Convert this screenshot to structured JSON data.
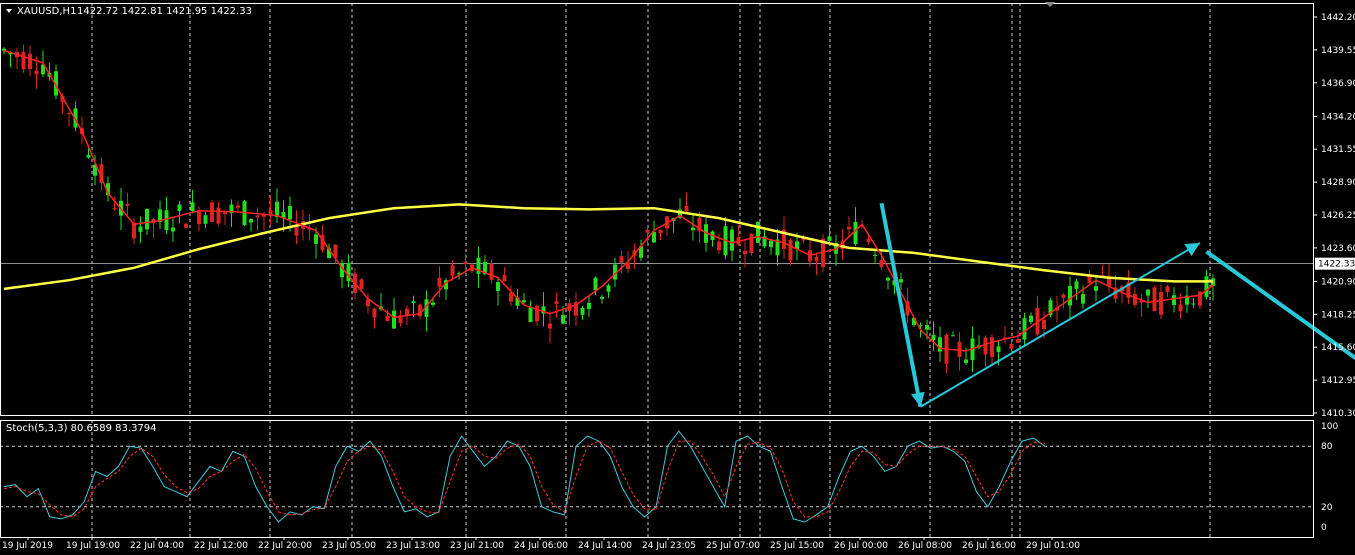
{
  "colors": {
    "background": "#000000",
    "bull": "#22dd22",
    "bear": "#dd2222",
    "ma_fast": "#ff2222",
    "ma_slow": "#ffff44",
    "arrow": "#28c8d8",
    "stoch_main": "#40c8d8",
    "stoch_signal": "#ff3333",
    "grid": "#ffffff",
    "price_tag_bg": "#ffffff",
    "price_tag_text": "#000000"
  },
  "header": {
    "symbol": "XAUUSD,H1",
    "values": "1422.72 1422.81 1421.95 1422.33"
  },
  "stoch_header": {
    "label": "Stoch(5,3,3) 80.6589 83.3794"
  },
  "chart_data": [
    {
      "type": "candlestick",
      "title": "XAUUSD,H1",
      "ylim": [
        1410.3,
        1443.0
      ],
      "y_ticks": [
        "1442.20",
        "1439.55",
        "1436.90",
        "1434.20",
        "1431.55",
        "1428.90",
        "1426.25",
        "1423.60",
        "1420.90",
        "1418.25",
        "1415.60",
        "1412.95",
        "1410.30"
      ],
      "current_price": "1422.33",
      "x_ticks": [
        "19 Jul 2019",
        "19 Jul 19:00",
        "22 Jul 04:00",
        "22 Jul 12:00",
        "22 Jul 20:00",
        "23 Jul 05:00",
        "23 Jul 13:00",
        "23 Jul 21:00",
        "24 Jul 06:00",
        "24 Jul 14:00",
        "24 Jul 23:05",
        "25 Jul 07:00",
        "25 Jul 15:00",
        "26 Jul 00:00",
        "26 Jul 08:00",
        "26 Jul 16:00",
        "29 Jul 01:00"
      ],
      "ma_fast_points": [
        [
          0,
          1439.5
        ],
        [
          6,
          1438.5
        ],
        [
          12,
          1433.0
        ],
        [
          16,
          1428.0
        ],
        [
          20,
          1425.5
        ],
        [
          24,
          1425.8
        ],
        [
          30,
          1426.6
        ],
        [
          36,
          1426.5
        ],
        [
          42,
          1426.2
        ],
        [
          48,
          1425.0
        ],
        [
          52,
          1422.0
        ],
        [
          56,
          1419.5
        ],
        [
          60,
          1418.0
        ],
        [
          64,
          1418.3
        ],
        [
          68,
          1420.8
        ],
        [
          72,
          1422.0
        ],
        [
          76,
          1421.2
        ],
        [
          80,
          1419.0
        ],
        [
          84,
          1418.3
        ],
        [
          88,
          1419.0
        ],
        [
          92,
          1420.5
        ],
        [
          96,
          1422.5
        ],
        [
          100,
          1425.0
        ],
        [
          104,
          1426.2
        ],
        [
          108,
          1424.8
        ],
        [
          112,
          1424.0
        ],
        [
          116,
          1424.5
        ],
        [
          120,
          1424.0
        ],
        [
          124,
          1423.0
        ],
        [
          128,
          1423.5
        ],
        [
          132,
          1425.5
        ],
        [
          135,
          1423.0
        ],
        [
          138,
          1420.0
        ],
        [
          141,
          1417.0
        ],
        [
          144,
          1415.5
        ],
        [
          148,
          1415.3
        ],
        [
          152,
          1416.0
        ],
        [
          156,
          1416.5
        ],
        [
          160,
          1418.0
        ],
        [
          164,
          1419.5
        ],
        [
          168,
          1421.0
        ],
        [
          172,
          1420.0
        ],
        [
          176,
          1419.2
        ],
        [
          180,
          1419.5
        ],
        [
          184,
          1419.8
        ],
        [
          186,
          1420.6
        ]
      ],
      "ma_slow_points": [
        [
          0,
          1420.3
        ],
        [
          10,
          1421.0
        ],
        [
          20,
          1422.0
        ],
        [
          30,
          1423.5
        ],
        [
          40,
          1424.8
        ],
        [
          50,
          1426.0
        ],
        [
          60,
          1426.8
        ],
        [
          70,
          1427.1
        ],
        [
          80,
          1426.8
        ],
        [
          90,
          1426.7
        ],
        [
          100,
          1426.8
        ],
        [
          110,
          1426.0
        ],
        [
          120,
          1424.8
        ],
        [
          130,
          1423.6
        ],
        [
          140,
          1423.2
        ],
        [
          150,
          1422.5
        ],
        [
          160,
          1421.8
        ],
        [
          170,
          1421.2
        ],
        [
          180,
          1420.9
        ],
        [
          186,
          1420.9
        ]
      ],
      "arrows": [
        {
          "from": [
            135,
            1427.2
          ],
          "to": [
            141,
            1410.8
          ]
        },
        {
          "from": [
            141,
            1410.8
          ],
          "to": [
            184,
            1424.0
          ]
        },
        {
          "from": [
            185,
            1423.3
          ],
          "to": [
            212,
            1413.2
          ]
        }
      ]
    },
    {
      "type": "line",
      "title": "Stoch(5,3,3) 80.6589 83.3794",
      "ylim": [
        0,
        100
      ],
      "y_ticks": [
        "100",
        "80",
        "20",
        "0"
      ],
      "levels": [
        80,
        20
      ],
      "series": [
        {
          "name": "main",
          "values": [
            40,
            42,
            30,
            38,
            10,
            8,
            12,
            25,
            55,
            50,
            60,
            80,
            78,
            60,
            40,
            35,
            30,
            45,
            60,
            55,
            75,
            70,
            40,
            20,
            5,
            15,
            12,
            20,
            18,
            60,
            80,
            75,
            85,
            70,
            40,
            15,
            18,
            10,
            15,
            70,
            90,
            75,
            60,
            70,
            85,
            80,
            60,
            20,
            15,
            12,
            80,
            90,
            85,
            70,
            40,
            20,
            10,
            20,
            80,
            95,
            80,
            60,
            40,
            20,
            85,
            90,
            80,
            75,
            40,
            8,
            5,
            12,
            20,
            50,
            75,
            80,
            70,
            55,
            60,
            80,
            85,
            78,
            80,
            75,
            65,
            35,
            20,
            40,
            65,
            85,
            88,
            80
          ]
        },
        {
          "name": "signal",
          "values": [
            38,
            40,
            35,
            33,
            22,
            12,
            10,
            18,
            40,
            48,
            55,
            70,
            78,
            70,
            52,
            40,
            34,
            38,
            50,
            55,
            65,
            72,
            58,
            35,
            15,
            12,
            13,
            17,
            19,
            40,
            65,
            75,
            80,
            76,
            55,
            30,
            20,
            15,
            14,
            45,
            75,
            80,
            70,
            68,
            78,
            82,
            70,
            40,
            22,
            15,
            50,
            80,
            85,
            78,
            55,
            32,
            18,
            17,
            55,
            85,
            85,
            70,
            52,
            30,
            60,
            82,
            84,
            78,
            58,
            25,
            10,
            10,
            15,
            35,
            60,
            75,
            74,
            62,
            60,
            72,
            80,
            80,
            80,
            77,
            70,
            50,
            30,
            35,
            52,
            75,
            84,
            83
          ]
        }
      ]
    }
  ]
}
